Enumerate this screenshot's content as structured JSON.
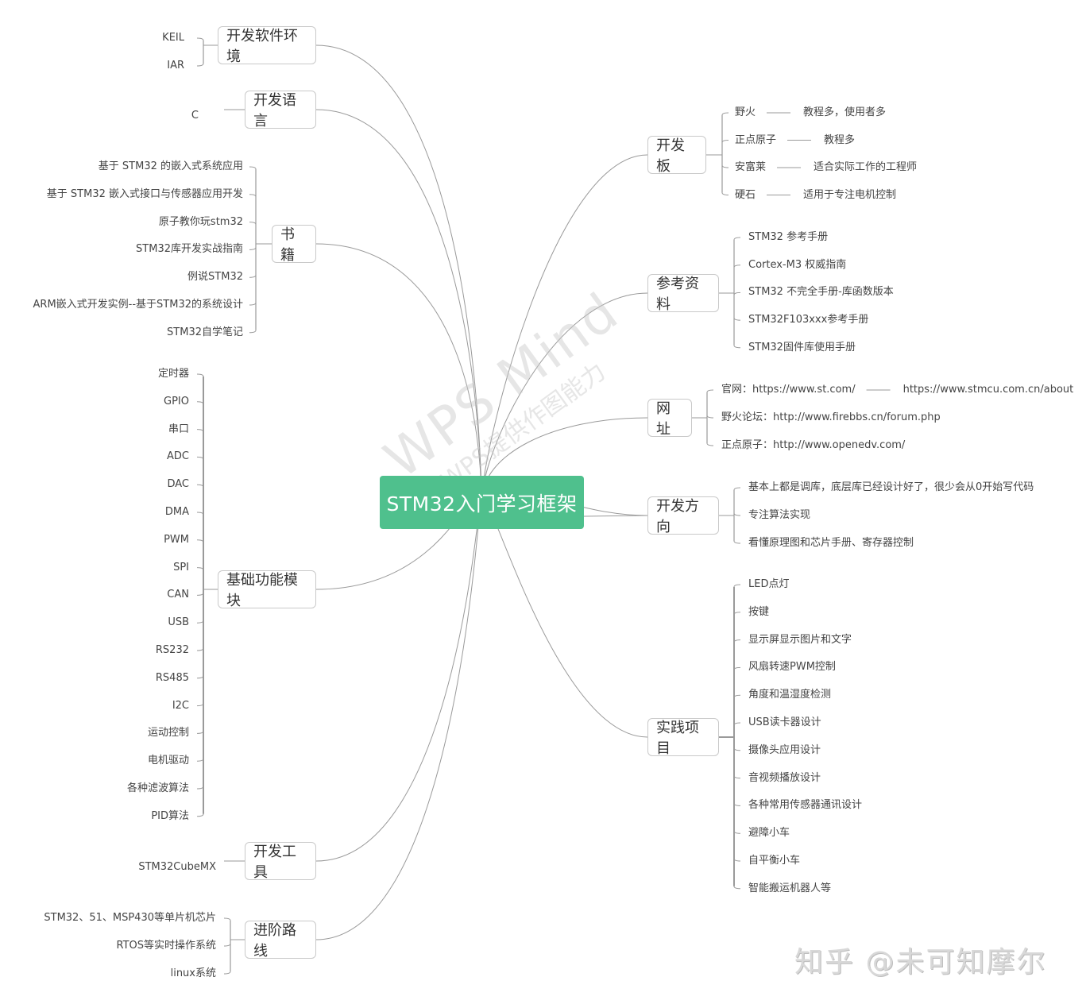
{
  "root": {
    "label": "STM32入门学习框架",
    "color": "#4fc08d"
  },
  "watermark": {
    "line1": "WPS Mind",
    "line2": "WPS提供作图能力"
  },
  "credit": "知乎 @未可知摩尔",
  "left_topics": [
    {
      "label": "开发软件环境",
      "children": [
        "KEIL",
        "IAR"
      ]
    },
    {
      "label": "开发语言",
      "children": [
        "C"
      ]
    },
    {
      "label": "书籍",
      "children": [
        "基于 STM32 的嵌入式系统应用",
        "基于 STM32 嵌入式接口与传感器应用开发",
        "原子教你玩stm32",
        "STM32库开发实战指南",
        "例说STM32",
        "ARM嵌入式开发实例--基于STM32的系统设计",
        "STM32自学笔记"
      ]
    },
    {
      "label": "基础功能模块",
      "children": [
        "定时器",
        "GPIO",
        "串口",
        "ADC",
        "DAC",
        "DMA",
        "PWM",
        "SPI",
        "CAN",
        "USB",
        "RS232",
        "RS485",
        "I2C",
        "运动控制",
        "电机驱动",
        "各种滤波算法",
        "PID算法"
      ]
    },
    {
      "label": "开发工具",
      "children": [
        "STM32CubeMX"
      ]
    },
    {
      "label": "进阶路线",
      "children": [
        "STM32、51、MSP430等单片机芯片",
        "RTOS等实时操作系统",
        "linux系统"
      ]
    }
  ],
  "right_topics": [
    {
      "label": "开发板",
      "children": [
        {
          "text": "野火",
          "note": "教程多，使用者多"
        },
        {
          "text": "正点原子",
          "note": "教程多"
        },
        {
          "text": "安富莱",
          "note": "适合实际工作的工程师"
        },
        {
          "text": "硬石",
          "note": "适用于专注电机控制"
        }
      ]
    },
    {
      "label": "参考资料",
      "children": [
        {
          "text": "STM32 参考手册"
        },
        {
          "text": "Cortex-M3 权威指南"
        },
        {
          "text": "STM32 不完全手册-库函数版本"
        },
        {
          "text": "STM32F103xxx参考手册"
        },
        {
          "text": "STM32固件库使用手册"
        }
      ]
    },
    {
      "label": "网址",
      "children": [
        {
          "text": "官网：https://www.st.com/",
          "note": "https://www.stmcu.com.cn/about"
        },
        {
          "text": "野火论坛：http://www.firebbs.cn/forum.php"
        },
        {
          "text": "正点原子：http://www.openedv.com/"
        }
      ]
    },
    {
      "label": "开发方向",
      "children": [
        {
          "text": "基本上都是调库，底层库已经设计好了，很少会从0开始写代码"
        },
        {
          "text": "专注算法实现"
        },
        {
          "text": "看懂原理图和芯片手册、寄存器控制"
        }
      ]
    },
    {
      "label": "实践项目",
      "children": [
        {
          "text": "LED点灯"
        },
        {
          "text": "按键"
        },
        {
          "text": "显示屏显示图片和文字"
        },
        {
          "text": "风扇转速PWM控制"
        },
        {
          "text": "角度和温湿度检测"
        },
        {
          "text": "USB读卡器设计"
        },
        {
          "text": "摄像头应用设计"
        },
        {
          "text": "音视频播放设计"
        },
        {
          "text": "各种常用传感器通讯设计"
        },
        {
          "text": "避障小车"
        },
        {
          "text": "自平衡小车"
        },
        {
          "text": "智能搬运机器人等"
        }
      ]
    }
  ]
}
